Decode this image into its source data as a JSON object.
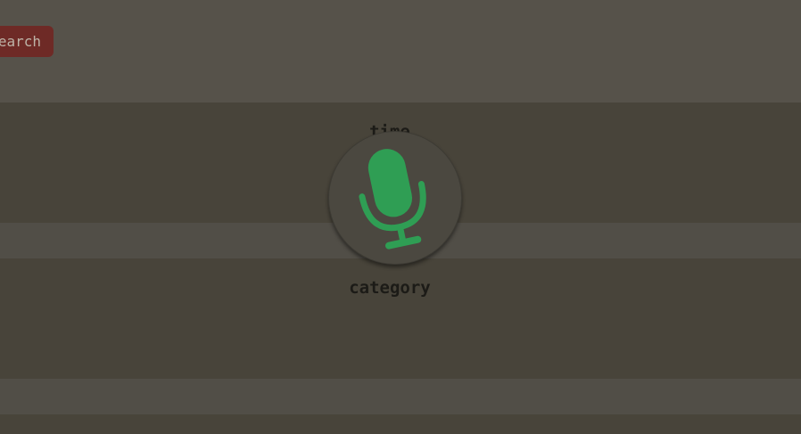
{
  "search": {
    "label": "earch",
    "color": "#6e2a26"
  },
  "voice_overlay": {
    "top_label": "time",
    "bottom_label": "category",
    "icon": "microphone-icon",
    "icon_color": "#2f9e54"
  }
}
